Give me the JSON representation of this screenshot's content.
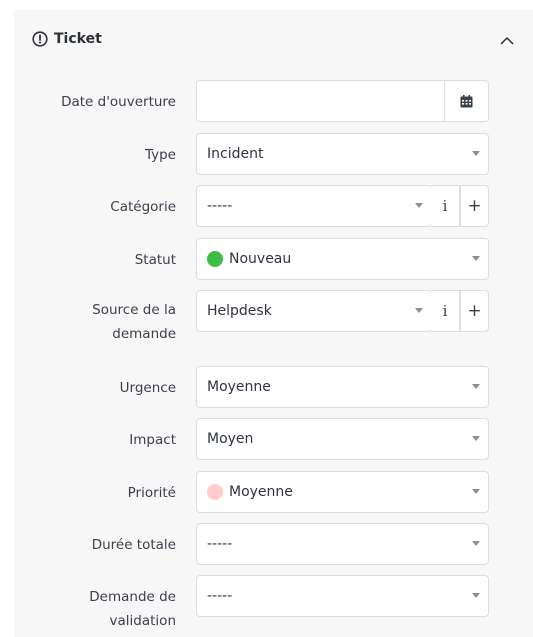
{
  "panel": {
    "title": "Ticket"
  },
  "fields": {
    "opening_date": {
      "label": "Date d'ouverture",
      "value": ""
    },
    "type": {
      "label": "Type",
      "value": "Incident"
    },
    "category": {
      "label": "Catégorie",
      "value": "-----",
      "info": "i",
      "add": "+"
    },
    "status": {
      "label": "Statut",
      "value": "Nouveau",
      "dot_color": "#3ebd45"
    },
    "request_source": {
      "label_line1": "Source de la",
      "label_line2": "demande",
      "value": "Helpdesk",
      "info": "i",
      "add": "+"
    },
    "urgency": {
      "label": "Urgence",
      "value": "Moyenne"
    },
    "impact": {
      "label": "Impact",
      "value": "Moyen"
    },
    "priority": {
      "label": "Priorité",
      "value": "Moyenne",
      "dot_color": "#ffcccc"
    },
    "total_duration": {
      "label": "Durée totale",
      "value": "-----"
    },
    "validation_request": {
      "label_line1": "Demande de",
      "label_line2": "validation",
      "value": "-----"
    }
  }
}
